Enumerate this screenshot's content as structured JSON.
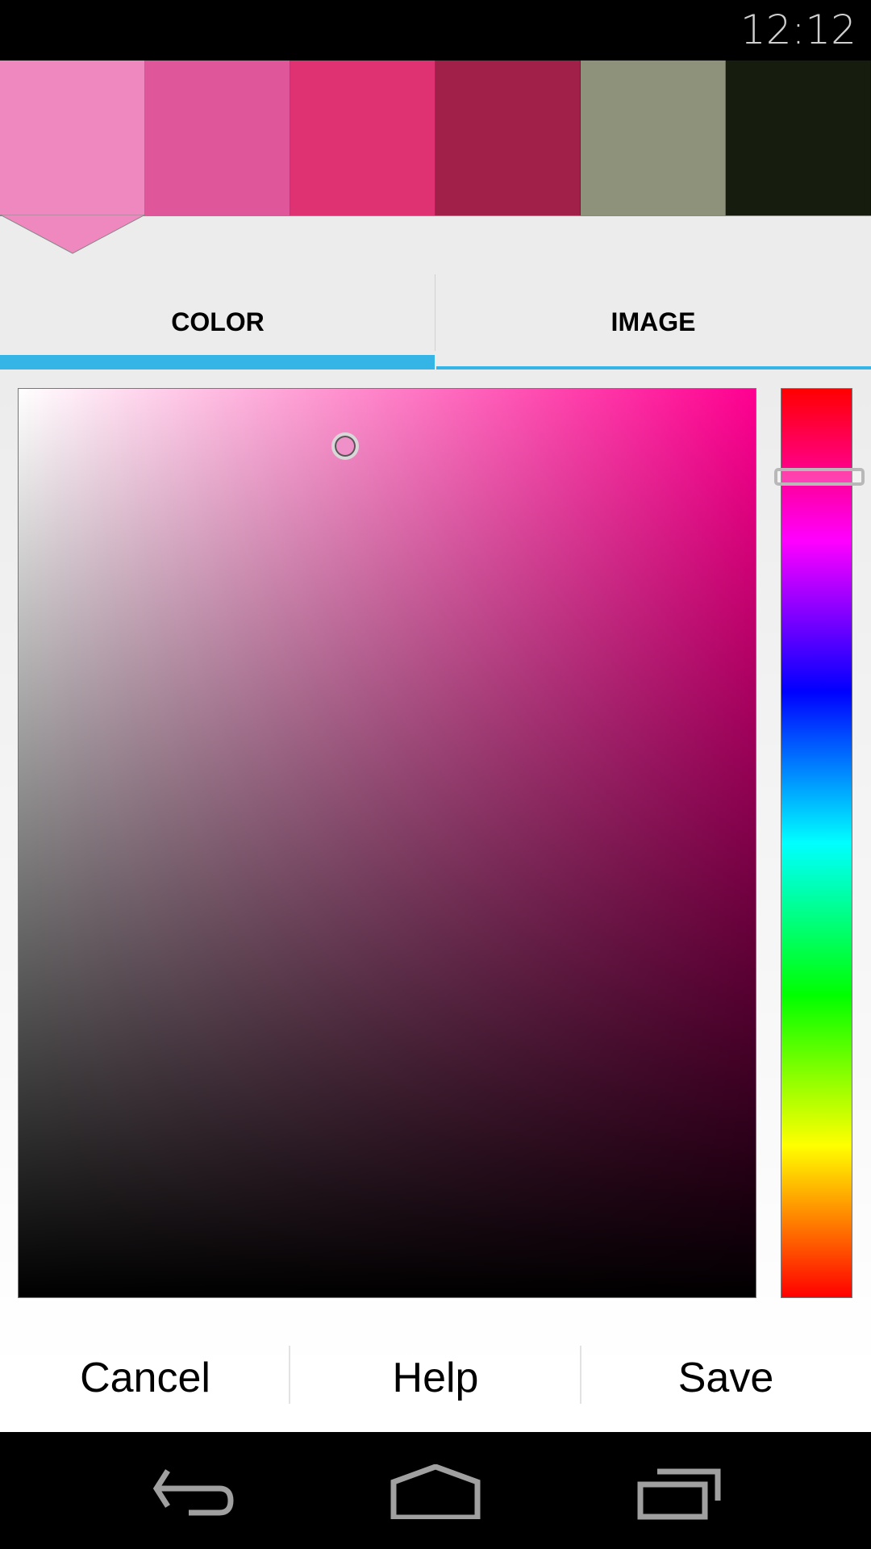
{
  "status_bar": {
    "time": "12:12"
  },
  "palette": {
    "selected_index": 0,
    "swatches": [
      "#F088C0",
      "#E0569A",
      "#DE3272",
      "#A0204A",
      "#8E927A",
      "#161D0E"
    ]
  },
  "tabs": [
    {
      "label": "COLOR",
      "active": true
    },
    {
      "label": "IMAGE",
      "active": false
    }
  ],
  "accent_color": "#35B5E5",
  "picker": {
    "hue_degrees": 326,
    "selected_color": "#F090C8"
  },
  "actions": {
    "cancel": "Cancel",
    "help": "Help",
    "save": "Save"
  },
  "nav": {
    "icons": [
      "back-icon",
      "home-icon",
      "recents-icon"
    ]
  }
}
